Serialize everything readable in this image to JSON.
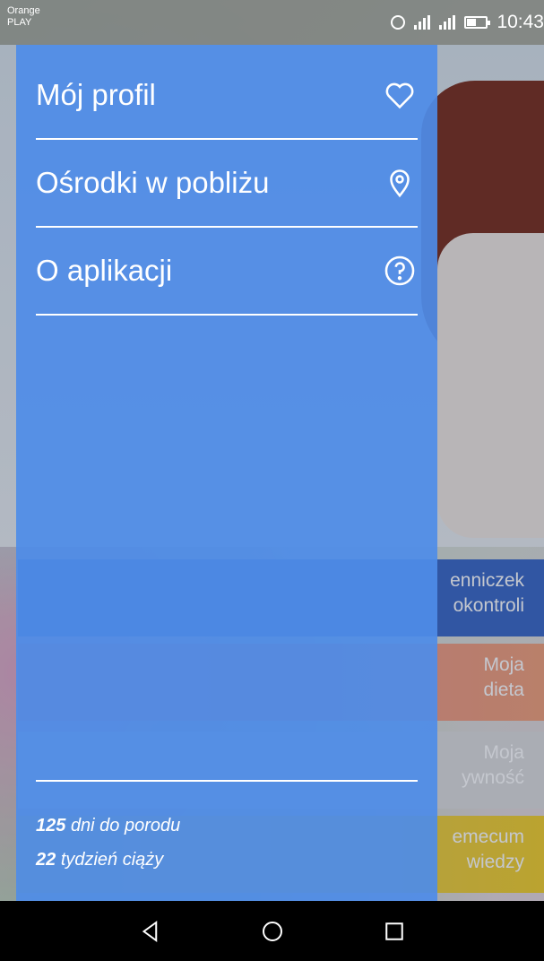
{
  "status_bar": {
    "carrier_line1": "Orange",
    "carrier_line2": "PLAY",
    "time": "10:43",
    "icons": [
      "alarm-icon",
      "signal-icon",
      "signal-h-icon",
      "battery-icon"
    ]
  },
  "background": {
    "tiles": [
      {
        "line1": "enniczek",
        "line2": "okontroli"
      },
      {
        "line1": "Moja",
        "line2": "dieta"
      },
      {
        "line1": "Moja",
        "line2": "ywność"
      },
      {
        "line1": "emecum",
        "line2": "wiedzy"
      }
    ]
  },
  "drawer": {
    "items": [
      {
        "label": "Mój profil",
        "icon": "heart-icon"
      },
      {
        "label": "Ośrodki w pobliżu",
        "icon": "location-pin-icon"
      },
      {
        "label": "O aplikacji",
        "icon": "help-circle-icon"
      }
    ],
    "stats": {
      "days_number": "125",
      "days_text": "dni do porodu",
      "week_number": "22",
      "week_text": "tydzień ciąży"
    },
    "colors": {
      "drawer_bg": "#4e8ce8",
      "text": "#ffffff"
    }
  },
  "nav_bar": {
    "buttons": [
      "back-icon",
      "home-icon",
      "recents-icon"
    ]
  }
}
